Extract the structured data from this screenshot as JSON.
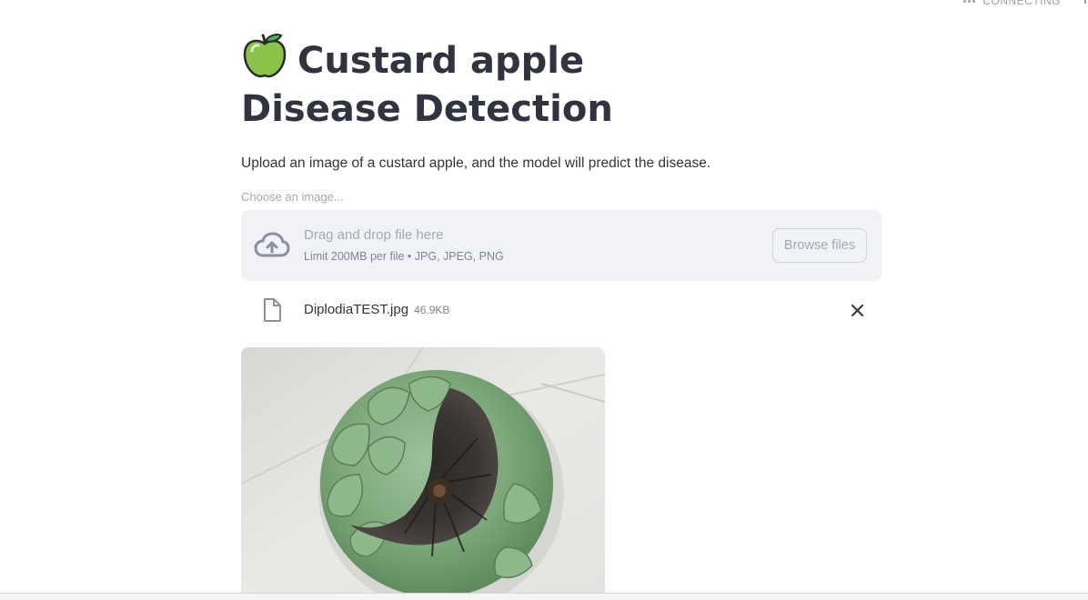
{
  "status": {
    "text": "CONNECTING"
  },
  "header": {
    "icon": "green-apple-icon",
    "title": "Custard apple Disease Detection"
  },
  "subtitle": "Upload an image of a custard apple, and the model will predict the disease.",
  "uploader": {
    "label": "Choose an image...",
    "drop_title": "Drag and drop file here",
    "limit_text": "Limit 200MB per file • JPG, JPEG, PNG",
    "browse_label": "Browse files",
    "icon": "cloud-upload-icon"
  },
  "uploaded_file": {
    "name": "DiplodiaTEST.jpg",
    "size": "46.9KB",
    "icon": "file-icon",
    "remove_icon": "close-icon"
  },
  "colors": {
    "text": "#31333f",
    "muted": "#a3a8b4",
    "dropzone_bg": "#f0f2f6"
  }
}
